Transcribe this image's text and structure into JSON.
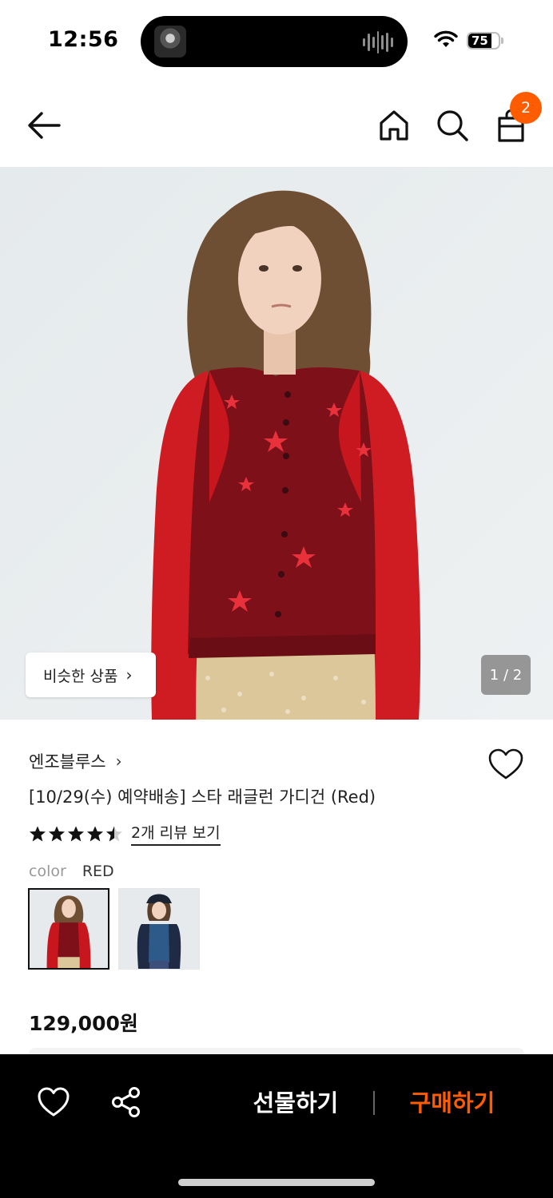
{
  "status_bar": {
    "time": "12:56",
    "battery": "75",
    "battery_level": 0.75
  },
  "header": {
    "icons": {
      "back": "arrow-left-icon",
      "home": "home-icon",
      "search": "search-icon",
      "cart": "shopping-bag-icon"
    },
    "cart_badge": "2",
    "accent_color": "#ff5c00"
  },
  "hero": {
    "similar_button": "비슷한 상품",
    "counter": "1 / 2"
  },
  "product": {
    "brand": "엔조블루스",
    "title": "[10/29(수) 예약배송] 스타 래글런 가디건 (Red)",
    "rating": 4.5,
    "review_link": "2개 리뷰 보기",
    "color_label": "color",
    "color_value": "RED",
    "price": "129,000원",
    "swatches": [
      {
        "name": "red-cardigan-option",
        "selected": true
      },
      {
        "name": "navy-cardigan-option",
        "selected": false
      }
    ]
  },
  "bottom_bar": {
    "gift": "선물하기",
    "buy": "구매하기",
    "icons": {
      "like": "heart-icon",
      "share": "share-icon"
    }
  }
}
